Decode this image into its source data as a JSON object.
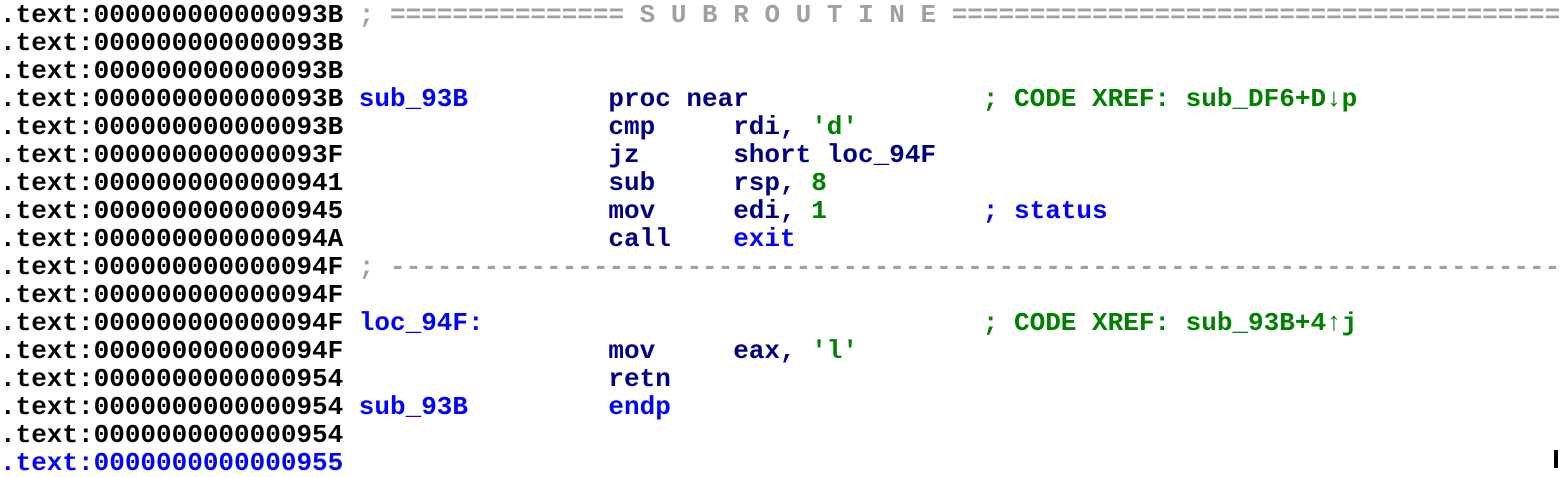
{
  "rows": [
    {
      "addr": ".text:000000000000093B",
      "segs": [
        {
          "col": 23,
          "cls": "sep",
          "text": "; =============== S U B R O U T I N E ======================================="
        }
      ]
    },
    {
      "addr": ".text:000000000000093B",
      "segs": []
    },
    {
      "addr": ".text:000000000000093B",
      "segs": []
    },
    {
      "addr": ".text:000000000000093B",
      "segs": [
        {
          "col": 23,
          "cls": "label",
          "text": "sub_93B"
        },
        {
          "col": 39,
          "cls": "mnem",
          "text": "proc near"
        },
        {
          "col": 63,
          "cls": "cmt-x",
          "text": "; CODE XREF: sub_DF6+D↓p"
        }
      ]
    },
    {
      "addr": ".text:000000000000093B",
      "segs": [
        {
          "col": 39,
          "cls": "mnem",
          "text": "cmp"
        },
        {
          "col": 47,
          "cls": "opnd",
          "text": "rdi,"
        },
        {
          "col": 52,
          "cls": "num",
          "text": "'d'"
        }
      ]
    },
    {
      "addr": ".text:000000000000093F",
      "segs": [
        {
          "col": 39,
          "cls": "mnem",
          "text": "jz"
        },
        {
          "col": 47,
          "cls": "opnd",
          "text": "short loc_94F"
        }
      ]
    },
    {
      "addr": ".text:0000000000000941",
      "segs": [
        {
          "col": 39,
          "cls": "mnem",
          "text": "sub"
        },
        {
          "col": 47,
          "cls": "opnd",
          "text": "rsp,"
        },
        {
          "col": 52,
          "cls": "num",
          "text": "8"
        }
      ]
    },
    {
      "addr": ".text:0000000000000945",
      "segs": [
        {
          "col": 39,
          "cls": "mnem",
          "text": "mov"
        },
        {
          "col": 47,
          "cls": "opnd",
          "text": "edi,"
        },
        {
          "col": 52,
          "cls": "num",
          "text": "1"
        },
        {
          "col": 63,
          "cls": "cmt-b",
          "text": "; status"
        }
      ]
    },
    {
      "addr": ".text:000000000000094A",
      "segs": [
        {
          "col": 39,
          "cls": "mnem",
          "text": "call"
        },
        {
          "col": 47,
          "cls": "label",
          "text": "exit"
        }
      ]
    },
    {
      "addr": ".text:000000000000094F",
      "segs": [
        {
          "col": 23,
          "cls": "sep",
          "text": "; ---------------------------------------------------------------------------"
        }
      ]
    },
    {
      "addr": ".text:000000000000094F",
      "segs": []
    },
    {
      "addr": ".text:000000000000094F",
      "segs": [
        {
          "col": 23,
          "cls": "label",
          "text": "loc_94F:"
        },
        {
          "col": 63,
          "cls": "cmt-x",
          "text": "; CODE XREF: sub_93B+4↑j"
        }
      ]
    },
    {
      "addr": ".text:000000000000094F",
      "segs": [
        {
          "col": 39,
          "cls": "mnem",
          "text": "mov"
        },
        {
          "col": 47,
          "cls": "opnd",
          "text": "eax,"
        },
        {
          "col": 52,
          "cls": "num",
          "text": "'l'"
        }
      ]
    },
    {
      "addr": ".text:0000000000000954",
      "segs": [
        {
          "col": 39,
          "cls": "mnem",
          "text": "retn"
        }
      ]
    },
    {
      "addr": ".text:0000000000000954",
      "segs": [
        {
          "col": 23,
          "cls": "label",
          "text": "sub_93B"
        },
        {
          "col": 39,
          "cls": "label",
          "text": "endp"
        }
      ]
    },
    {
      "addr": ".text:0000000000000954",
      "segs": []
    },
    {
      "addr": ".text:0000000000000955",
      "current": true,
      "segs": []
    }
  ]
}
